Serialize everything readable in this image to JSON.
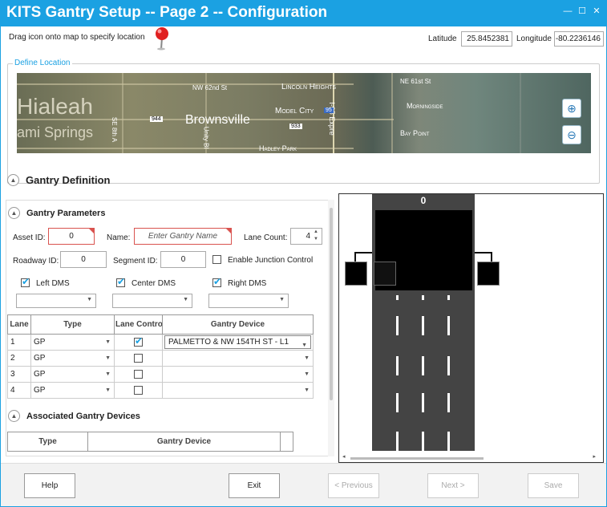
{
  "window": {
    "title": "KITS Gantry Setup -- Page 2 -- Configuration"
  },
  "header": {
    "hint": "Drag icon onto map to specify location",
    "latitude_label": "Latitude",
    "latitude_value": "25.8452381",
    "longitude_label": "Longitude",
    "longitude_value": "-80.2236146"
  },
  "location": {
    "group_label": "Define Location",
    "map_labels": [
      "Hialeah",
      "ami Springs",
      "Brownsville",
      "NW 62nd St",
      "Lincoln Heights",
      "Model City",
      "Hadley Park",
      "NE 61st St",
      "Morningside",
      "Bay Point",
      "I-95 Expre",
      "SE 8th A",
      "Unity Bl"
    ],
    "route_shields": [
      "944",
      "933",
      "95"
    ]
  },
  "gantry_definition": {
    "title": "Gantry Definition"
  },
  "gantry_parameters": {
    "title": "Gantry Parameters",
    "asset_id_label": "Asset ID:",
    "asset_id_value": "0",
    "name_label": "Name:",
    "name_placeholder": "Enter Gantry Name",
    "lane_count_label": "Lane Count:",
    "lane_count_value": "4",
    "roadway_id_label": "Roadway ID:",
    "roadway_id_value": "0",
    "segment_id_label": "Segment ID:",
    "segment_id_value": "0",
    "junction_label": "Enable Junction Control",
    "left_dms_label": "Left DMS",
    "center_dms_label": "Center DMS",
    "right_dms_label": "Right DMS"
  },
  "lanes_table": {
    "headers": [
      "Lane",
      "Type",
      "Lane Control",
      "Gantry Device"
    ],
    "rows": [
      {
        "lane": "1",
        "type": "GP",
        "control": true,
        "device": "PALMETTO & NW 154TH ST - L1"
      },
      {
        "lane": "2",
        "type": "GP",
        "control": false,
        "device": ""
      },
      {
        "lane": "3",
        "type": "GP",
        "control": false,
        "device": ""
      },
      {
        "lane": "4",
        "type": "GP",
        "control": false,
        "device": ""
      }
    ]
  },
  "associated": {
    "title": "Associated Gantry Devices",
    "headers": [
      "Type",
      "Gantry Device"
    ]
  },
  "preview": {
    "gantry_number": "0"
  },
  "footer": {
    "help": "Help",
    "exit": "Exit",
    "previous": "< Previous",
    "next": "Next >",
    "save": "Save"
  }
}
